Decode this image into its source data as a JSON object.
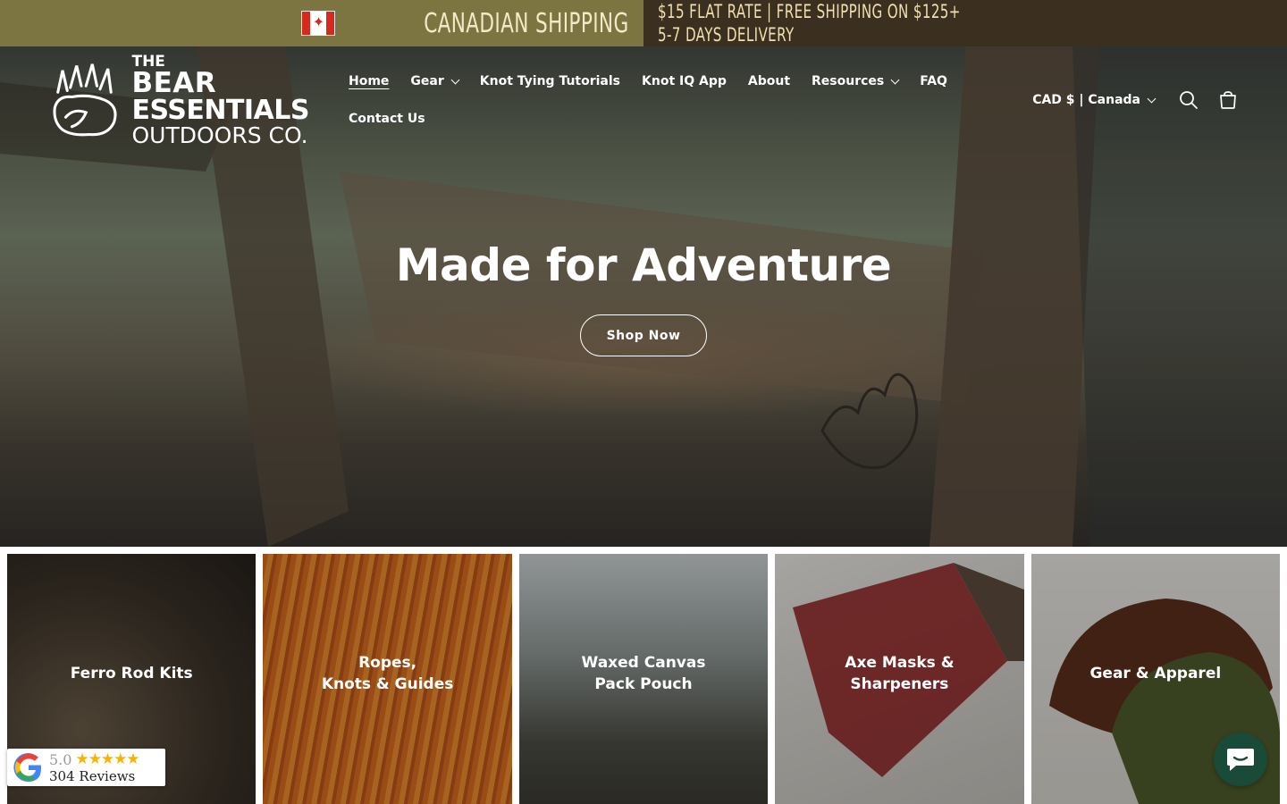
{
  "announcement": {
    "left_title": "CANADIAN SHIPPING",
    "line1": "$15 FLAT RATE | FREE SHIPPING ON $125+",
    "line2": "5-7 DAYS DELIVERY",
    "flag_icon": "canada-flag-icon"
  },
  "header": {
    "logo": {
      "line1": "THE",
      "line2": "BEAR",
      "line3": "ESSENTIALS",
      "line4": "OUTDOORS CO."
    },
    "nav": [
      {
        "label": "Home",
        "active": true,
        "dropdown": false
      },
      {
        "label": "Gear",
        "active": false,
        "dropdown": true
      },
      {
        "label": "Knot Tying Tutorials",
        "active": false,
        "dropdown": false
      },
      {
        "label": "Knot IQ App",
        "active": false,
        "dropdown": false
      },
      {
        "label": "About",
        "active": false,
        "dropdown": false
      },
      {
        "label": "Resources",
        "active": false,
        "dropdown": true
      },
      {
        "label": "FAQ",
        "active": false,
        "dropdown": false
      },
      {
        "label": "Contact Us",
        "active": false,
        "dropdown": false
      }
    ],
    "currency": "CAD $ | Canada",
    "icons": [
      "search-icon",
      "cart-icon"
    ]
  },
  "hero": {
    "title": "Made for Adventure",
    "button": "Shop Now"
  },
  "collections": [
    {
      "label": "Ferro Rod Kits"
    },
    {
      "label": "Ropes,\nKnots & Guides"
    },
    {
      "label": "Waxed Canvas\nPack Pouch"
    },
    {
      "label": "Axe Masks &\nSharpeners"
    },
    {
      "label": "Gear & Apparel"
    }
  ],
  "reviews_badge": {
    "score": "5.0",
    "stars": "★★★★★",
    "count": "304 Reviews"
  },
  "colors": {
    "announce_left": "#7c7542",
    "announce_right": "#3b2f1f",
    "announce_text": "#f1dfb0",
    "chat_button": "#1a4a38",
    "star": "#f5b400"
  }
}
